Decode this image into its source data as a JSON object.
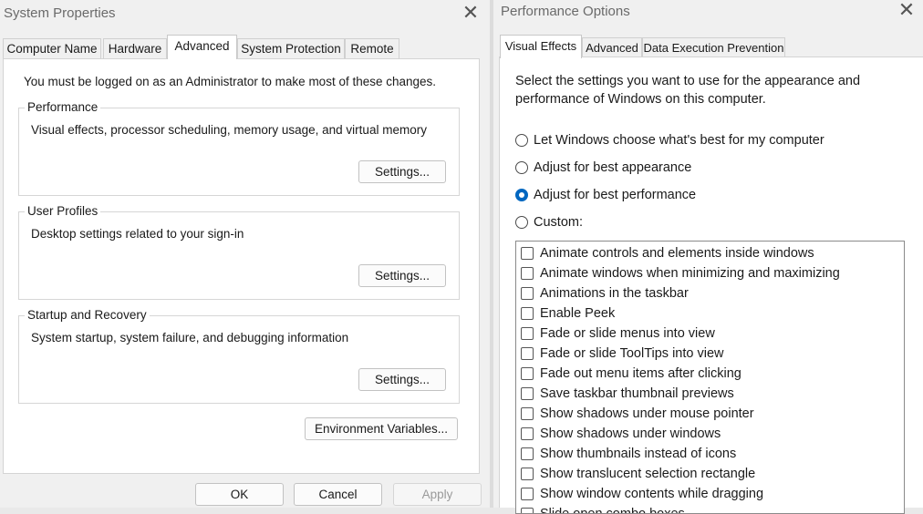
{
  "system_properties": {
    "title": "System Properties",
    "tabs": [
      "Computer Name",
      "Hardware",
      "Advanced",
      "System Protection",
      "Remote"
    ],
    "active_tab": "Advanced",
    "notice": "You must be logged on as an Administrator to make most of these changes.",
    "groups": [
      {
        "legend": "Performance",
        "description": "Visual effects, processor scheduling, memory usage, and virtual memory",
        "button": "Settings..."
      },
      {
        "legend": "User Profiles",
        "description": "Desktop settings related to your sign-in",
        "button": "Settings..."
      },
      {
        "legend": "Startup and Recovery",
        "description": "System startup, system failure, and debugging information",
        "button": "Settings..."
      }
    ],
    "env_button": "Environment Variables...",
    "footer": {
      "ok": "OK",
      "cancel": "Cancel",
      "apply": "Apply"
    }
  },
  "performance_options": {
    "title": "Performance Options",
    "tabs": [
      "Visual Effects",
      "Advanced",
      "Data Execution Prevention"
    ],
    "active_tab": "Visual Effects",
    "intro": "Select the settings you want to use for the appearance and performance of Windows on this computer.",
    "options": [
      {
        "label": "Let Windows choose what's best for my computer",
        "selected": false
      },
      {
        "label": "Adjust for best appearance",
        "selected": false
      },
      {
        "label": "Adjust for best performance",
        "selected": true
      },
      {
        "label": "Custom:",
        "selected": false
      }
    ],
    "effects": [
      "Animate controls and elements inside windows",
      "Animate windows when minimizing and maximizing",
      "Animations in the taskbar",
      "Enable Peek",
      "Fade or slide menus into view",
      "Fade or slide ToolTips into view",
      "Fade out menu items after clicking",
      "Save taskbar thumbnail previews",
      "Show shadows under mouse pointer",
      "Show shadows under windows",
      "Show thumbnails instead of icons",
      "Show translucent selection rectangle",
      "Show window contents while dragging",
      "Slide open combo boxes"
    ]
  },
  "icons": {
    "close": "close-icon"
  },
  "colors": {
    "accent": "#0067c0",
    "dialog_bg": "#f0f0f0",
    "page_bg": "#ffffff"
  }
}
